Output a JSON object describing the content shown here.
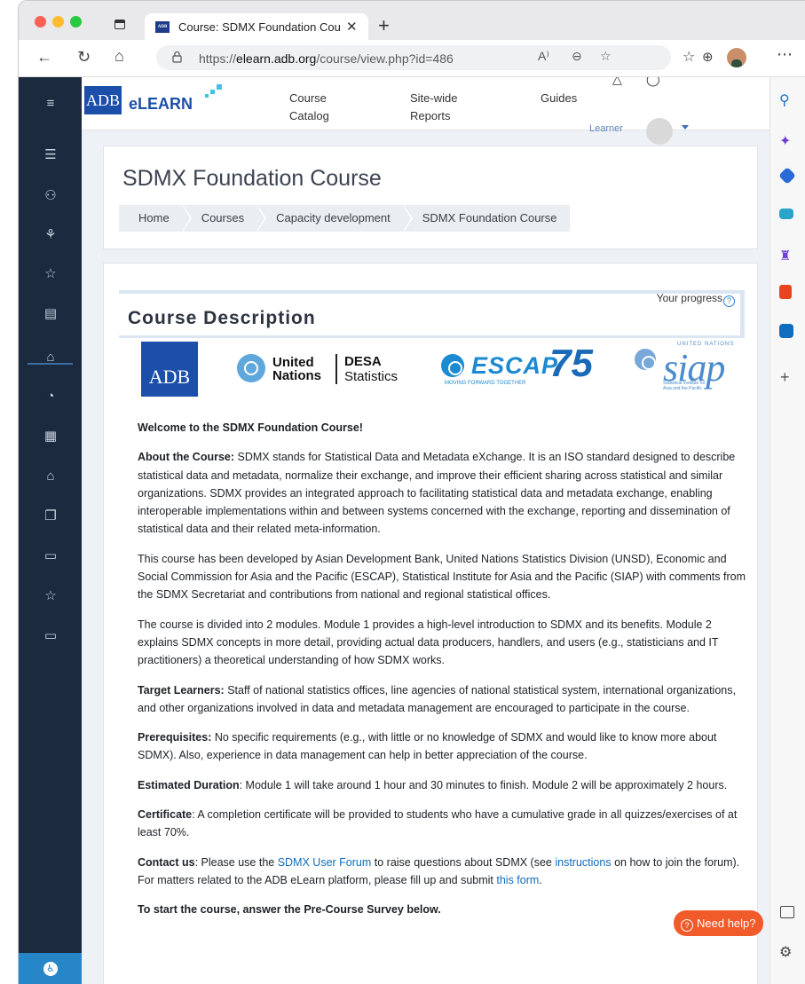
{
  "browser": {
    "tab_title": "Course: SDMX Foundation Cou",
    "tab_favicon_text": "ADB",
    "url_prefix": "https://",
    "url_host": "elearn.adb.org",
    "url_path": "/course/view.php?id=486"
  },
  "site": {
    "logo_mark": "ADB",
    "logo_text": "eLEARN",
    "menu": [
      {
        "line1": "Course",
        "line2": "Catalog"
      },
      {
        "line1": "Site-wide",
        "line2": "Reports"
      },
      {
        "line1": "Guides",
        "line2": ""
      }
    ],
    "user_role": "Learner"
  },
  "header": {
    "title": "SDMX Foundation Course",
    "breadcrumb": [
      "Home",
      "Courses",
      "Capacity development",
      "SDMX Foundation Course"
    ]
  },
  "section": {
    "heading": "Course Description",
    "progress_label": "Your progress",
    "progress_help": "?"
  },
  "partner_logos": {
    "adb": "ADB",
    "un_line1": "United",
    "un_line2": "Nations",
    "desa_line1": "DESA",
    "desa_line2": "Statistics",
    "escap": "ESCAP",
    "escap_num": "75",
    "escap_tagline": "MOVING FORWARD TOGETHER",
    "siap_un": "UNITED NATIONS",
    "siap": "siap",
    "siap_sub_1": "Statistical Institute for",
    "siap_sub_2": "Asia and the Pacific"
  },
  "content": {
    "welcome": "Welcome to the SDMX Foundation Course!",
    "about_label": "About the Course:",
    "about_text": " SDMX stands for Statistical Data and Metadata eXchange. It is an ISO standard designed to describe statistical data and metadata, normalize their exchange, and improve their efficient sharing across statistical and similar organizations. SDMX provides an integrated approach to facilitating statistical data and metadata exchange, enabling interoperable implementations within and between systems concerned with the exchange, reporting and dissemination of statistical data and their related meta-information.",
    "developed": "This course has been developed by Asian Development Bank, United Nations Statistics Division (UNSD), Economic and Social Commission for Asia and the Pacific (ESCAP), Statistical Institute for Asia and the Pacific (SIAP) with comments from the SDMX Secretariat and contributions from national and regional statistical offices.",
    "modules": "The course is divided into 2 modules. Module 1 provides a high-level introduction to SDMX and its benefits. Module 2 explains SDMX concepts in more detail, providing actual data producers, handlers, and users (e.g., statisticians and IT practitioners) a theoretical understanding of how SDMX works.",
    "target_label": "Target Learners:",
    "target_text": " Staff of national statistics offices, line agencies of national statistical system, international organizations, and other organizations involved in data and metadata management are encouraged to participate in the course.",
    "prereq_label": "Prerequisites:",
    "prereq_text": " No specific requirements (e.g., with little or no knowledge of SDMX and would like to know more about SDMX). Also, experience in data management can help in better appreciation of the course.",
    "duration_label": "Estimated Duration",
    "duration_text": ": Module 1 will take around 1 hour and 30 minutes to finish. Module 2 will be approximately 2 hours.",
    "cert_label": "Certificate",
    "cert_text": ": A completion certificate will be provided to students who have a cumulative grade in all quizzes/exercises of at least 70%.",
    "contact_label": "Contact us",
    "contact_t1": ": Please use the ",
    "contact_link1": "SDMX User Forum",
    "contact_t2": " to raise questions about SDMX (see ",
    "contact_link2": "instructions",
    "contact_t3": " on how to join the forum). For matters related to the ADB eLearn platform, please fill up and submit ",
    "contact_link3": "this form",
    "contact_t4": ".",
    "start": "To start the course, answer the Pre-Course Survey below."
  },
  "help_button": {
    "icon": "?",
    "label": "Need help?"
  },
  "colors": {
    "accent": "#0f6cbf",
    "drawer": "#1b2a3e",
    "help": "#f15a29",
    "adb_blue": "#1c4faa"
  }
}
